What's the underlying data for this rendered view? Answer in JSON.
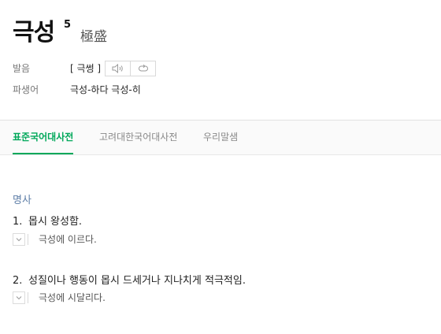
{
  "entry": {
    "headword": "극성",
    "homograph_number": "5",
    "hanja": "極盛"
  },
  "pronunciation": {
    "label": "발음",
    "value": "[ 극썽 ]",
    "icons": [
      "speaker-icon",
      "repeat-icon"
    ]
  },
  "derivatives": {
    "label": "파생어",
    "value": "극성-하다 극성-히"
  },
  "tabs": [
    {
      "label": "표준국어대사전",
      "active": true
    },
    {
      "label": "고려대한국어대사전",
      "active": false
    },
    {
      "label": "우리말샘",
      "active": false
    }
  ],
  "senses": {
    "part_of_speech": "명사",
    "items": [
      {
        "number": "1.",
        "definition": "몹시 왕성함.",
        "example": "극성에 이르다."
      },
      {
        "number": "2.",
        "definition": "성질이나 행동이 몹시 드세거나 지나치게 적극적임.",
        "example": "극성에 시달리다."
      }
    ]
  },
  "colors": {
    "accent_green": "#00a85a",
    "pos_blue": "#5f7fa8",
    "label_gray": "#777777"
  }
}
